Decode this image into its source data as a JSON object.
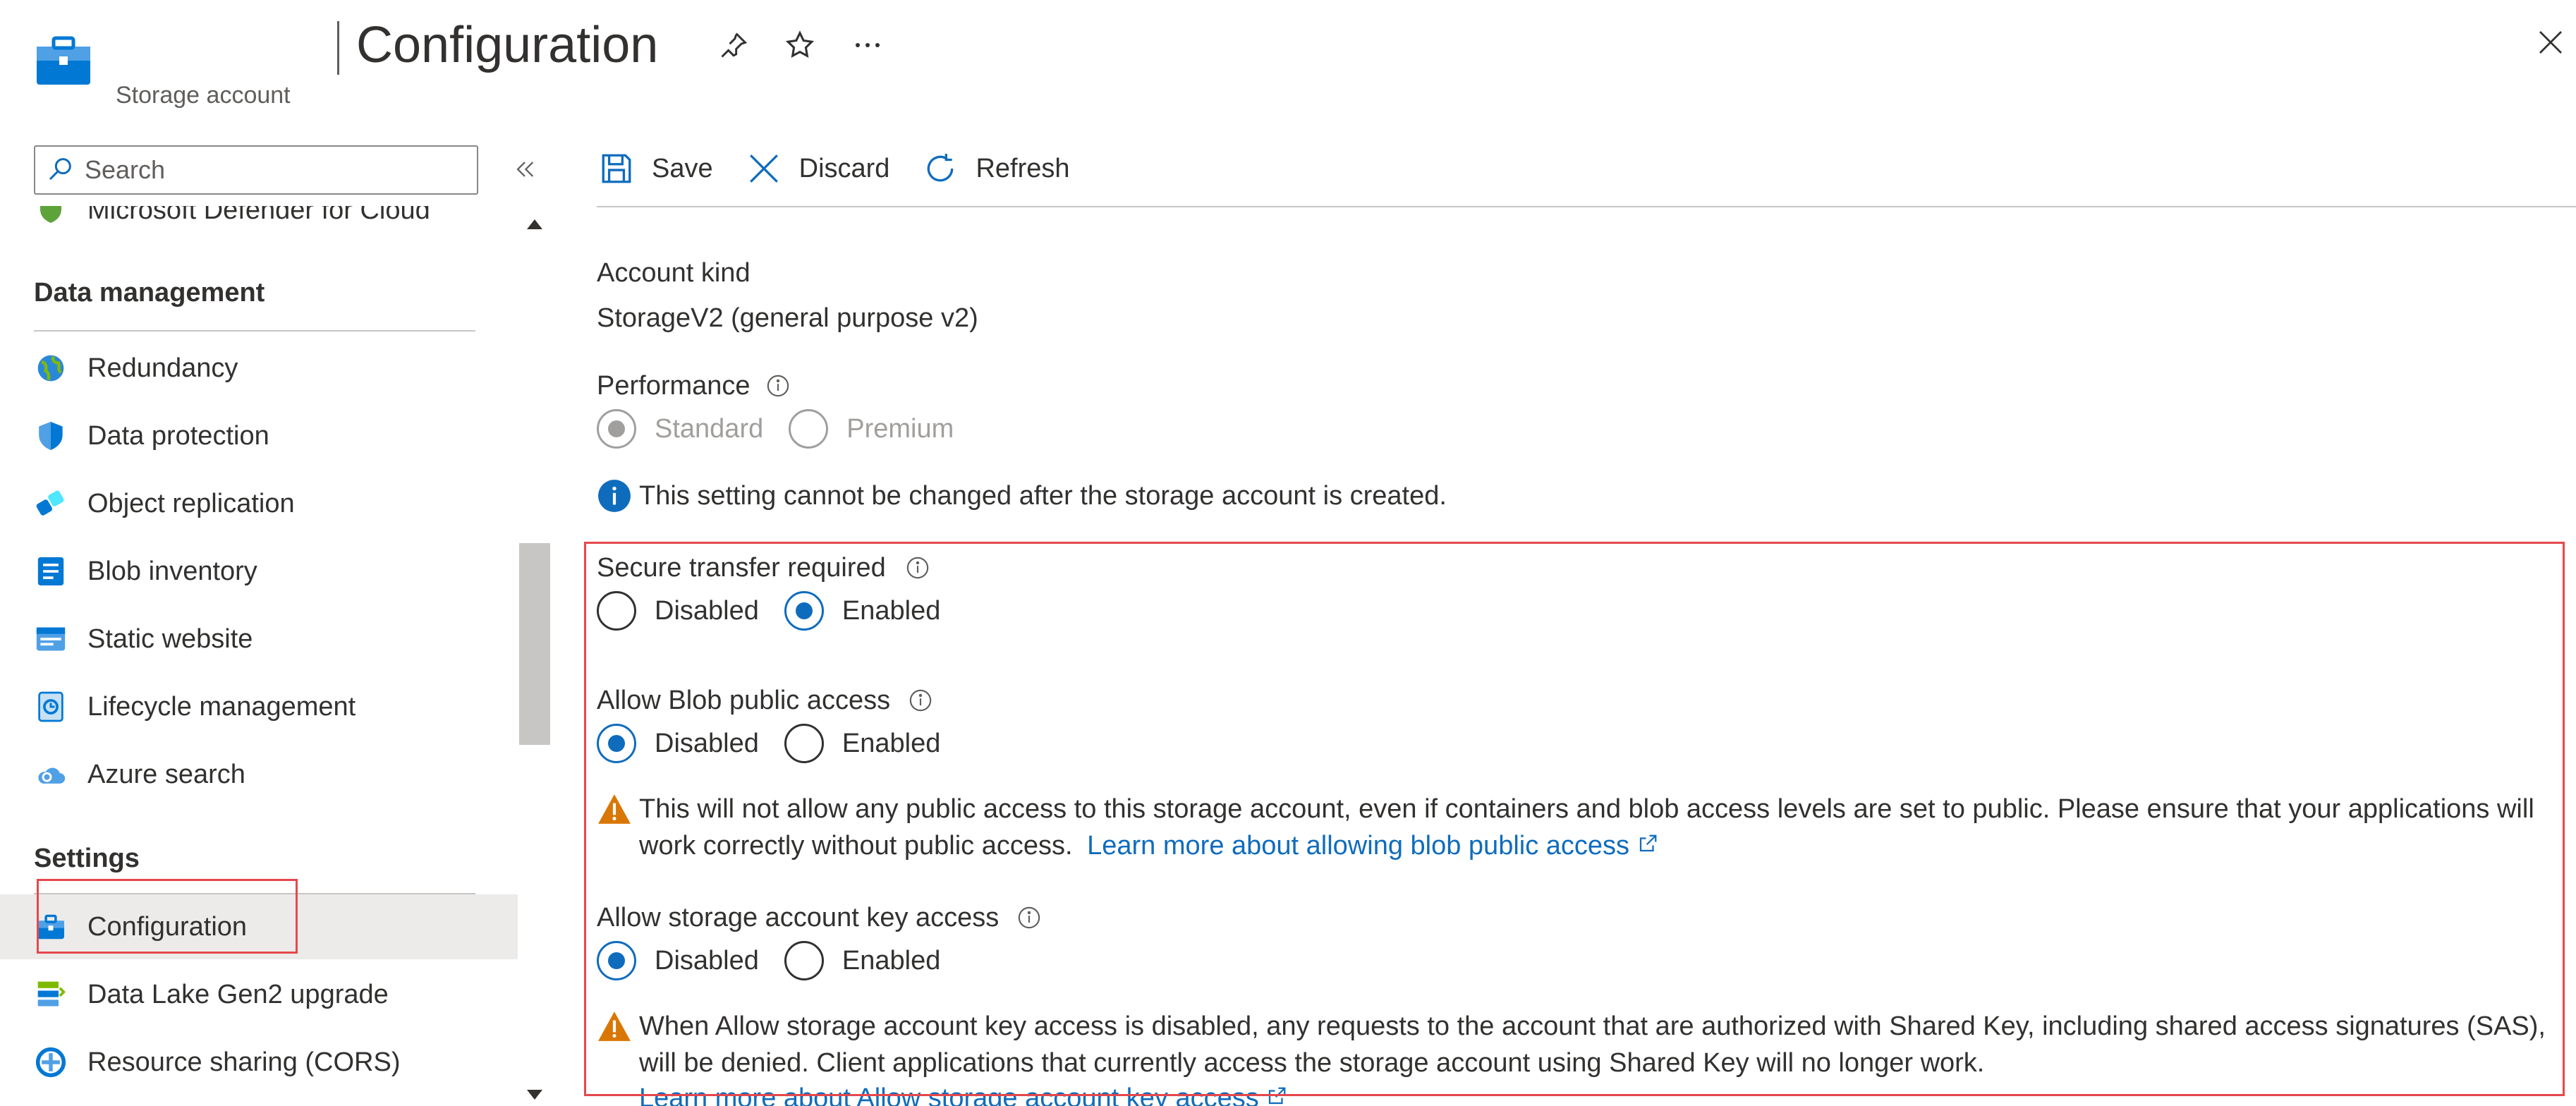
{
  "header": {
    "title": "Configuration",
    "subtitle": "Storage account"
  },
  "sidebar": {
    "search_placeholder": "Search",
    "items": [
      {
        "label": "Microsoft Defender for Cloud",
        "icon": "defender-shield-icon"
      },
      {
        "label": "Redundancy",
        "icon": "globe-icon"
      },
      {
        "label": "Data protection",
        "icon": "shield-icon"
      },
      {
        "label": "Object replication",
        "icon": "replication-icon"
      },
      {
        "label": "Blob inventory",
        "icon": "inventory-icon"
      },
      {
        "label": "Static website",
        "icon": "website-icon"
      },
      {
        "label": "Lifecycle management",
        "icon": "lifecycle-icon"
      },
      {
        "label": "Azure search",
        "icon": "cloud-search-icon"
      },
      {
        "label": "Configuration",
        "icon": "toolbox-icon",
        "selected": true
      },
      {
        "label": "Data Lake Gen2 upgrade",
        "icon": "datalake-icon"
      },
      {
        "label": "Resource sharing (CORS)",
        "icon": "cors-icon"
      }
    ],
    "sections": {
      "data_management": "Data management",
      "settings": "Settings"
    }
  },
  "toolbar": {
    "save": "Save",
    "discard": "Discard",
    "refresh": "Refresh"
  },
  "main": {
    "account_kind_label": "Account kind",
    "account_kind_value": "StorageV2 (general purpose v2)",
    "performance_label": "Performance",
    "performance_options": [
      "Standard",
      "Premium"
    ],
    "performance_selected": "Standard",
    "performance_note": "This setting cannot be changed after the storage account is created.",
    "secure_transfer_label": "Secure transfer required",
    "secure_transfer_selected": "Enabled",
    "blob_public_label": "Allow Blob public access",
    "blob_public_selected": "Disabled",
    "blob_public_warning_line1": "This will not allow any public access to this storage account, even if containers and blob access levels are set to public. Please ensure that your applications will",
    "blob_public_warning_line2": "work correctly without public access.",
    "blob_public_link": "Learn more about allowing blob public access",
    "key_access_label": "Allow storage account key access",
    "key_access_selected": "Disabled",
    "key_access_warning_line1": "When Allow storage account key access is disabled, any requests to the account that are authorized with Shared Key, including shared access signatures (SAS),",
    "key_access_warning_line2": "will be denied. Client applications that currently access the storage account using Shared Key will no longer work.",
    "key_access_link": "Learn more about Allow storage account key access",
    "option_disabled": "Disabled",
    "option_enabled": "Enabled"
  },
  "colors": {
    "accent": "#0f6cbd",
    "highlight": "#e5484d",
    "warning": "#d97706"
  }
}
